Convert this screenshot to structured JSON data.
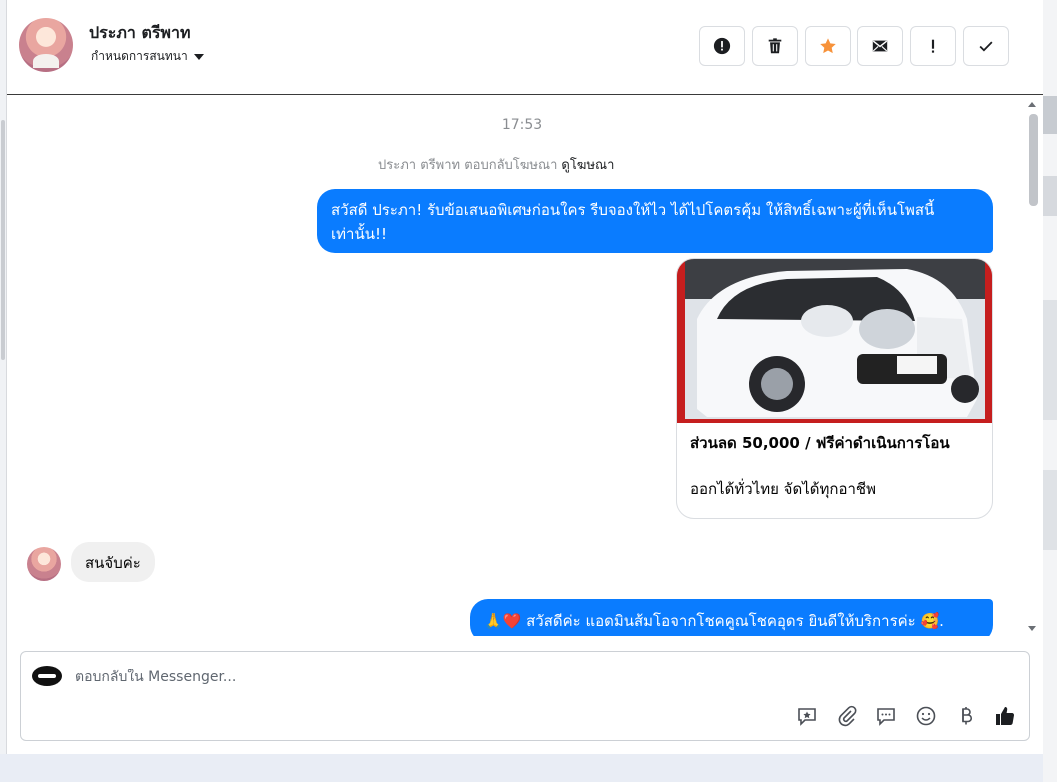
{
  "header": {
    "contact_name": "ประภา ตรีพาท",
    "assign_label": "กำหนดการสนทนา",
    "actions": [
      {
        "id": "report",
        "icon": "alert-circle-icon"
      },
      {
        "id": "delete",
        "icon": "trash-icon"
      },
      {
        "id": "star",
        "icon": "star-icon",
        "color": "#f7923a"
      },
      {
        "id": "mark-unread",
        "icon": "envelope-icon"
      },
      {
        "id": "flag",
        "icon": "exclamation-icon"
      },
      {
        "id": "done",
        "icon": "check-icon"
      }
    ]
  },
  "thread": {
    "timestamp": "17:53",
    "ad_reply_text": "ประภา ตรีพาท ตอบกลับโฆษณา",
    "ad_link": "ดูโฆษณา",
    "messages": [
      {
        "from": "page",
        "text": "สวัสดี ประภา! รับข้อเสนอพิเศษก่อนใคร รีบจองให้ไว ได้ไปโคตรคุ้ม ให้สิทธิ์เฉพาะผู้ที่เห็นโพสนี้เท่านั้น!!"
      },
      {
        "from": "page",
        "type": "card",
        "title": "ส่วนลด 50,000 / ฟรีค่าดำเนินการโอน",
        "subtitle": "ออกได้ทั่วไทย จัดได้ทุกอาชีพ"
      },
      {
        "from": "contact",
        "text": "สนจับค่ะ"
      },
      {
        "from": "page",
        "text": "🙏❤️ สวัสดีค่ะ แอดมินส้มโอจากโชคคูณโชคอุดร ยินดีให้บริการค่ะ 🥰."
      }
    ]
  },
  "composer": {
    "placeholder": "ตอบกลับใน Messenger...",
    "tools": [
      "saved-reply-icon",
      "attachment-icon",
      "chat-bubble-icon",
      "emoji-icon",
      "baht-icon",
      "thumbs-up-icon"
    ]
  },
  "colors": {
    "outgoing_bubble": "#0a7cff",
    "incoming_bubble": "#f0f0f0",
    "star": "#f7923a"
  }
}
